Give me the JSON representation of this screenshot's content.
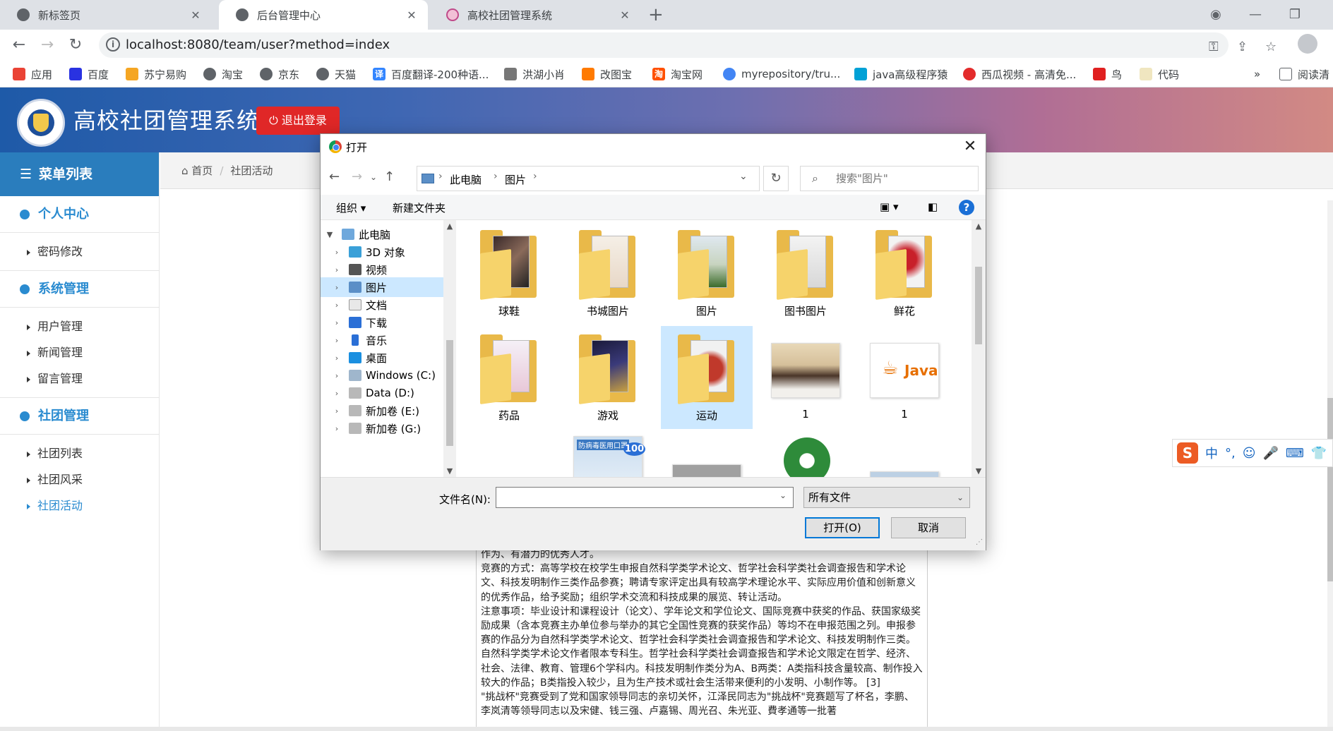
{
  "browser": {
    "tabs": [
      {
        "title": "新标签页",
        "close": "✕"
      },
      {
        "title": "后台管理中心",
        "close": "✕"
      },
      {
        "title": "高校社团管理系统",
        "close": "✕"
      }
    ],
    "new_tab": "+",
    "url": "localhost:8080/team/user?method=index",
    "bookmarks": [
      "应用",
      "百度",
      "苏宁易购",
      "淘宝",
      "京东",
      "天猫",
      "百度翻译-200种语...",
      "洪湖小肖",
      "改图宝",
      "淘宝网",
      "myrepository/tru...",
      "java高级程序猿",
      "西瓜视频 - 高清免...",
      "鸟",
      "代码"
    ],
    "bookmarks_more": "»",
    "reading_list": "阅读清"
  },
  "site": {
    "name": "高校社团管理系统",
    "logout": "退出登录"
  },
  "sidebar": {
    "header": "菜单列表",
    "groups": [
      {
        "label": "个人中心",
        "items": [
          "密码修改"
        ]
      },
      {
        "label": "系统管理",
        "items": [
          "用户管理",
          "新闻管理",
          "留言管理"
        ]
      },
      {
        "label": "社团管理",
        "items": [
          "社团列表",
          "社团风采",
          "社团活动"
        ]
      }
    ],
    "active_item": "社团活动"
  },
  "breadcrumb": {
    "home": "首页",
    "current": "社团活动"
  },
  "article": {
    "paragraphs": [
      "作为、有潜力的优秀人才。",
      "竞赛的方式：高等学校在校学生申报自然科学类学术论文、哲学社会科学类社会调查报告和学术论文、科技发明制作三类作品参赛；聘请专家评定出具有较高学术理论水平、实际应用价值和创新意义的优秀作品，给予奖励；组织学术交流和科技成果的展览、转让活动。",
      "注意事项：毕业设计和课程设计（论文）、学年论文和学位论文、国际竞赛中获奖的作品、获国家级奖励成果（含本竞赛主办单位参与举办的其它全国性竞赛的获奖作品）等均不在申报范围之列。申报参赛的作品分为自然科学类学术论文、哲学社会科学类社会调查报告和学术论文、科技发明制作三类。自然科学类学术论文作者限本专科生。哲学社会科学类社会调查报告和学术论文限定在哲学、经济、社会、法律、教育、管理6个学科内。科技发明制作类分为A、B两类：A类指科技含量较高、制作投入较大的作品；B类指投入较少，且为生产技术或社会生活带来便利的小发明、小制作等。 [3]",
      "\"挑战杯\"竞赛受到了党和国家领导同志的亲切关怀，江泽民同志为\"挑战杯\"竞赛题写了杯名，李鹏、李岚清等领导同志以及宋健、钱三强、卢嘉锡、周光召、朱光亚、費孝通等一批著"
    ]
  },
  "dialog": {
    "title": "打开",
    "close": "✕",
    "path": [
      "此电脑",
      "图片"
    ],
    "search_placeholder": "搜索\"图片\"",
    "toolbar": {
      "organize": "组织 ▾",
      "new_folder": "新建文件夹",
      "help": "?"
    },
    "tree": [
      {
        "label": "此电脑",
        "expanded": true
      },
      {
        "label": "3D 对象"
      },
      {
        "label": "视频"
      },
      {
        "label": "图片",
        "selected": true
      },
      {
        "label": "文档"
      },
      {
        "label": "下载"
      },
      {
        "label": "音乐"
      },
      {
        "label": "桌面"
      },
      {
        "label": "Windows (C:)"
      },
      {
        "label": "Data (D:)"
      },
      {
        "label": "新加卷 (E:)"
      },
      {
        "label": "新加卷 (G:)"
      }
    ],
    "files": [
      {
        "name": "球鞋",
        "kind": "folder"
      },
      {
        "name": "书城图片",
        "kind": "folder"
      },
      {
        "name": "图片",
        "kind": "folder"
      },
      {
        "name": "图书图片",
        "kind": "folder"
      },
      {
        "name": "鲜花",
        "kind": "folder"
      },
      {
        "name": "药品",
        "kind": "folder"
      },
      {
        "name": "游戏",
        "kind": "folder"
      },
      {
        "name": "运动",
        "kind": "folder",
        "selected": true
      },
      {
        "name": "1",
        "kind": "image"
      },
      {
        "name": "1",
        "kind": "image"
      }
    ],
    "thumb_text": {
      "java": "Java",
      "mask": "防病毒医用口罩",
      "mask_count": "100"
    },
    "filename_label": "文件名(N):",
    "filename_value": "",
    "filetype": "所有文件",
    "open_button": "打开(O)",
    "cancel_button": "取消"
  },
  "ime": {
    "logo": "S",
    "mode": "中",
    "punct": "°,"
  }
}
